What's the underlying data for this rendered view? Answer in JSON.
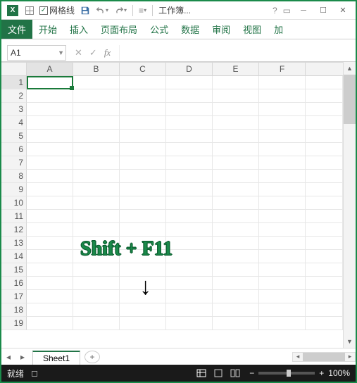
{
  "titlebar": {
    "gridlines_label": "网格线",
    "workbook_title": "工作簿...",
    "gridlines_checked": true
  },
  "ribbon": {
    "tabs": [
      "文件",
      "开始",
      "插入",
      "页面布局",
      "公式",
      "数据",
      "审阅",
      "视图",
      "加"
    ]
  },
  "namebox": {
    "value": "A1"
  },
  "columns": [
    "A",
    "B",
    "C",
    "D",
    "E",
    "F"
  ],
  "rows": [
    "1",
    "2",
    "3",
    "4",
    "5",
    "6",
    "7",
    "8",
    "9",
    "10",
    "11",
    "12",
    "13",
    "14",
    "15",
    "16",
    "17",
    "18",
    "19"
  ],
  "sheet_tabs": {
    "active": "Sheet1"
  },
  "status": {
    "ready": "就绪",
    "zoom": "100%"
  },
  "overlay": {
    "text": "Shift + F11",
    "arrow": "↓"
  },
  "icons": {
    "formula_cancel": "✕",
    "formula_enter": "✓",
    "formula_fx": "fx",
    "add_sheet": "+",
    "zoom_out": "−",
    "zoom_in": "+"
  }
}
